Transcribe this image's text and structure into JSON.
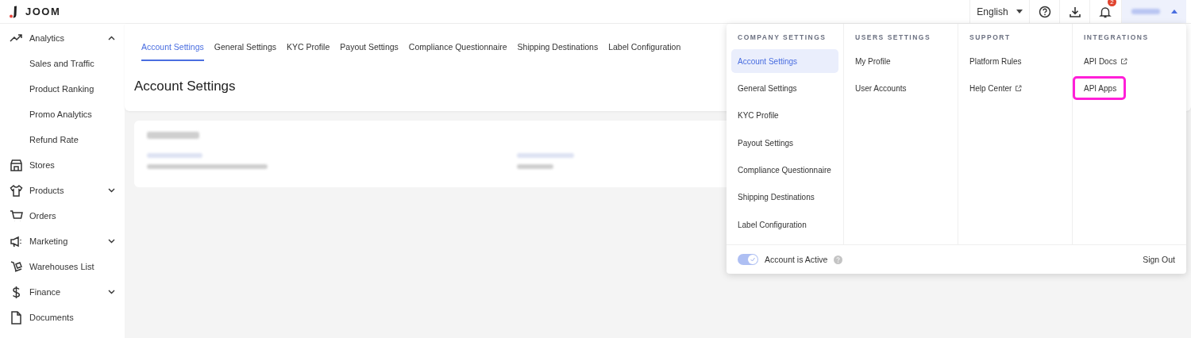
{
  "brand": {
    "name": "JOOM"
  },
  "topbar": {
    "language": "English",
    "notifications": "2"
  },
  "sidebar": {
    "items": [
      {
        "label": "Analytics",
        "expanded": true,
        "children": [
          {
            "label": "Sales and Traffic"
          },
          {
            "label": "Product Ranking"
          },
          {
            "label": "Promo Analytics"
          },
          {
            "label": "Refund Rate"
          }
        ]
      },
      {
        "label": "Stores"
      },
      {
        "label": "Products",
        "expanded": false
      },
      {
        "label": "Orders"
      },
      {
        "label": "Marketing",
        "expanded": false
      },
      {
        "label": "Warehouses List"
      },
      {
        "label": "Finance",
        "expanded": false
      },
      {
        "label": "Documents"
      }
    ]
  },
  "tabs": [
    {
      "label": "Account Settings",
      "selected": true
    },
    {
      "label": "General Settings",
      "selected": false
    },
    {
      "label": "KYC Profile",
      "selected": false
    },
    {
      "label": "Payout Settings",
      "selected": false
    },
    {
      "label": "Compliance Questionnaire",
      "selected": false
    },
    {
      "label": "Shipping Destinations",
      "selected": false
    },
    {
      "label": "Label Configuration",
      "selected": false
    }
  ],
  "page_title": "Account Settings",
  "menu": {
    "columns": [
      {
        "heading": "COMPANY SETTINGS",
        "items": [
          {
            "label": "Account Settings",
            "selected": true,
            "external": false,
            "highlighted": false
          },
          {
            "label": "General Settings",
            "selected": false,
            "external": false,
            "highlighted": false
          },
          {
            "label": "KYC Profile",
            "selected": false,
            "external": false,
            "highlighted": false
          },
          {
            "label": "Payout Settings",
            "selected": false,
            "external": false,
            "highlighted": false
          },
          {
            "label": "Compliance Questionnaire",
            "selected": false,
            "external": false,
            "highlighted": false
          },
          {
            "label": "Shipping Destinations",
            "selected": false,
            "external": false,
            "highlighted": false
          },
          {
            "label": "Label Configuration",
            "selected": false,
            "external": false,
            "highlighted": false
          }
        ]
      },
      {
        "heading": "USERS SETTINGS",
        "items": [
          {
            "label": "My Profile",
            "selected": false,
            "external": false,
            "highlighted": false
          },
          {
            "label": "User Accounts",
            "selected": false,
            "external": false,
            "highlighted": false
          }
        ]
      },
      {
        "heading": "SUPPORT",
        "items": [
          {
            "label": "Platform Rules",
            "selected": false,
            "external": false,
            "highlighted": false
          },
          {
            "label": "Help Center",
            "selected": false,
            "external": true,
            "highlighted": false
          }
        ]
      },
      {
        "heading": "INTEGRATIONS",
        "items": [
          {
            "label": "API Docs",
            "selected": false,
            "external": true,
            "highlighted": false
          },
          {
            "label": "API Apps",
            "selected": false,
            "external": false,
            "highlighted": true
          }
        ]
      }
    ],
    "toggle": {
      "label": "Account is Active",
      "on": true
    },
    "sign_out": "Sign Out"
  }
}
